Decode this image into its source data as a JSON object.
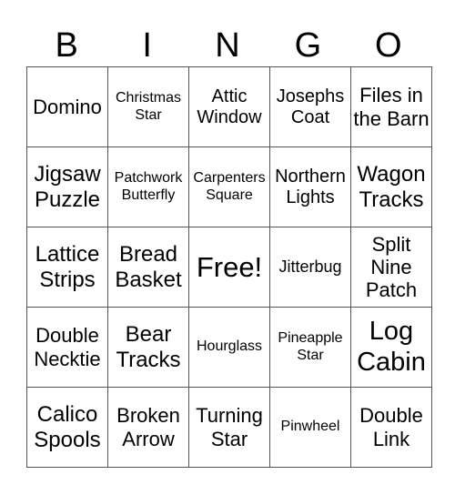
{
  "header": [
    "B",
    "I",
    "N",
    "G",
    "O"
  ],
  "cells": [
    [
      "Domino",
      "Christmas Star",
      "Attic Window",
      "Josephs Coat",
      "Files in the Barn"
    ],
    [
      "Jigsaw Puzzle",
      "Patchwork Butterfly",
      "Carpenters Square",
      "Northern Lights",
      "Wagon Tracks"
    ],
    [
      "Lattice Strips",
      "Bread Basket",
      "Free!",
      "Jitterbug",
      "Split Nine Patch"
    ],
    [
      "Double Necktie",
      "Bear Tracks",
      "Hourglass",
      "Pineapple Star",
      "Log Cabin"
    ],
    [
      "Calico Spools",
      "Broken Arrow",
      "Turning Star",
      "Pinwheel",
      "Double Link"
    ]
  ]
}
